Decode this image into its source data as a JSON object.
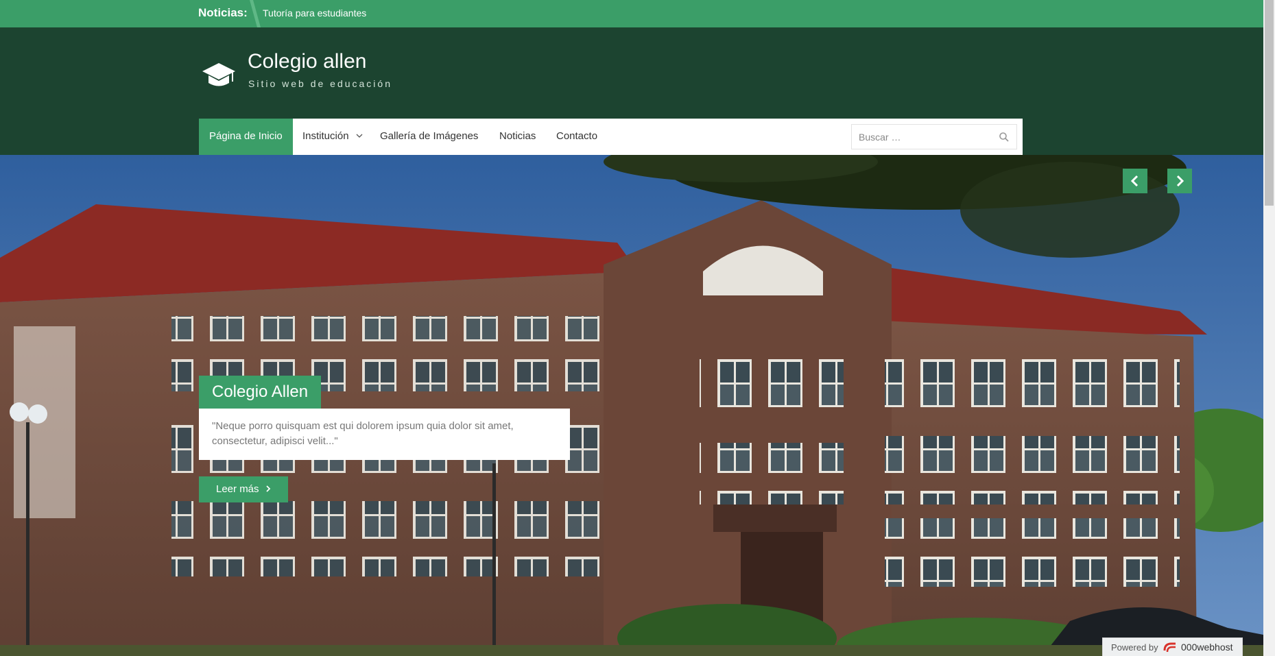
{
  "ticker": {
    "label": "Noticias:",
    "text": "Tutoría para estudiantes"
  },
  "header": {
    "site_title": "Colegio allen",
    "tagline": "Sitio web de educación",
    "logo_icon": "graduation-cap-icon"
  },
  "nav": {
    "items": [
      {
        "label": "Página de Inicio",
        "active": true
      },
      {
        "label": "Institución",
        "has_submenu": true
      },
      {
        "label": "Gallería de Imágenes"
      },
      {
        "label": "Noticias"
      },
      {
        "label": "Contacto"
      }
    ],
    "search_placeholder": "Buscar …"
  },
  "hero": {
    "caption_title": "Colegio Allen",
    "caption_text": "\"Neque porro quisquam est qui dolorem ipsum quia dolor sit amet, consectetur, adipisci velit...\"",
    "read_more": "Leer más"
  },
  "footer_badge": {
    "powered_by": "Powered by",
    "brand": "000webhost"
  },
  "colors": {
    "accent": "#3b9e68",
    "header_bg": "#1c4430"
  }
}
